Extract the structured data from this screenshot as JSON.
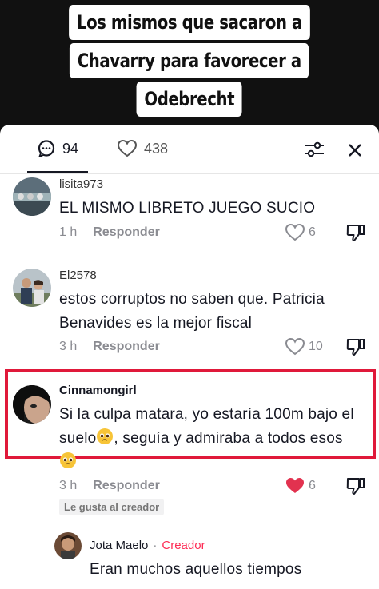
{
  "caption": {
    "line1": "Los mismos que sacaron a",
    "line2": "Chavarry para favorecer a",
    "line3": "Odebrecht"
  },
  "tabs": {
    "comments_count": "94",
    "likes_count": "438"
  },
  "comments": [
    {
      "username": "lisita973",
      "text": "EL MISMO LIBRETO JUEGO SUCIO",
      "time": "1 h",
      "reply_label": "Responder",
      "likes": "6"
    },
    {
      "username": "El2578",
      "text": "estos corruptos no saben que. Patricia Benavides es la mejor fiscal",
      "time": "3 h",
      "reply_label": "Responder",
      "likes": "10"
    },
    {
      "username": "Cinnamongirl",
      "text_part1": "Si la culpa matara, yo estaría 100m bajo el suelo",
      "text_part2": ", seguía y admiraba a todos esos",
      "time": "3 h",
      "reply_label": "Responder",
      "likes": "6",
      "creator_badge": "Le gusta al creador"
    }
  ],
  "reply": {
    "username": "Jota Maelo",
    "separator": "·",
    "creator_label": "Creador",
    "text": "Eran muchos aquellos tiempos"
  },
  "colors": {
    "highlight_border": "#e0193a",
    "liked_heart": "#fe2c55",
    "creator_label": "#fe2c55"
  }
}
